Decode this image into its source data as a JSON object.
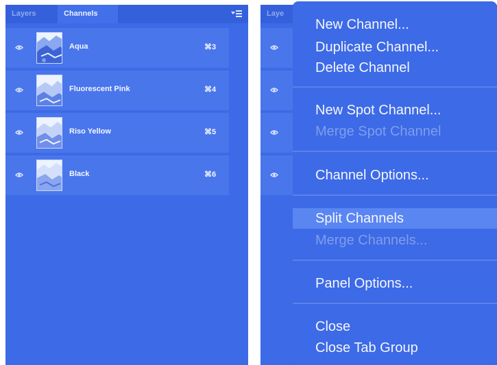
{
  "tabs": {
    "layers": "Layers",
    "channels": "Channels",
    "layers_truncated": "Laye"
  },
  "channels": [
    {
      "name": "Aqua",
      "shortcut": "⌘3"
    },
    {
      "name": "Fluorescent Pink",
      "shortcut": "⌘4"
    },
    {
      "name": "Riso Yellow",
      "shortcut": "⌘5"
    },
    {
      "name": "Black",
      "shortcut": "⌘6"
    }
  ],
  "menu": {
    "new_channel": "New Channel...",
    "duplicate_channel": "Duplicate Channel...",
    "delete_channel": "Delete Channel",
    "new_spot_channel": "New Spot Channel...",
    "merge_spot_channel": "Merge Spot Channel",
    "channel_options": "Channel Options...",
    "split_channels": "Split Channels",
    "merge_channels": "Merge Channels...",
    "panel_options": "Panel Options...",
    "close": "Close",
    "close_tab_group": "Close Tab Group"
  },
  "menu_state": {
    "highlighted": "Split Channels",
    "disabled": [
      "Merge Spot Channel",
      "Merge Channels..."
    ]
  },
  "icons": [
    "eye-icon",
    "panel-menu-icon",
    "channel-thumbnail"
  ],
  "colors": {
    "panel_bg": "#3d6ae6",
    "row_bg": "#4a76ec",
    "highlight": "#5a86f2",
    "text": "#f4f7ff",
    "disabled_text": "#7f9eec"
  }
}
